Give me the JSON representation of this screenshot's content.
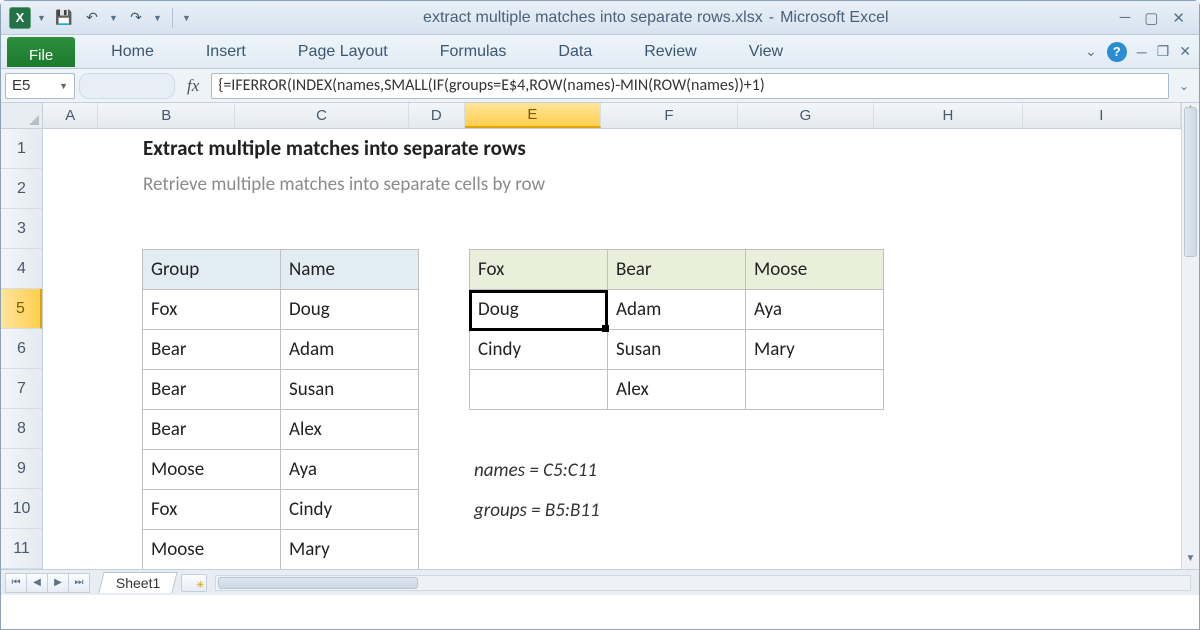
{
  "titlebar": {
    "filename": "extract multiple matches into separate rows.xlsx",
    "separator": "-",
    "app": "Microsoft Excel"
  },
  "ribbon": {
    "file": "File",
    "tabs": [
      "Home",
      "Insert",
      "Page Layout",
      "Formulas",
      "Data",
      "Review",
      "View"
    ]
  },
  "namebox": "E5",
  "fx_label": "fx",
  "formula": "{=IFERROR(INDEX(names,SMALL(IF(groups=E$4,ROW(names)-MIN(ROW(names))+1)",
  "colwidths": {
    "A": 56,
    "B": 138,
    "C": 176,
    "D": 56,
    "E": 138,
    "F": 138,
    "G": 138,
    "H": 150,
    "I": 160
  },
  "columns": [
    "A",
    "B",
    "C",
    "D",
    "E",
    "F",
    "G",
    "H",
    "I"
  ],
  "rows": [
    "1",
    "2",
    "3",
    "4",
    "5",
    "6",
    "7",
    "8",
    "9",
    "10",
    "11"
  ],
  "selected": {
    "col": "E",
    "row": "5",
    "cell": "E5"
  },
  "content": {
    "title": "Extract multiple matches into separate rows",
    "subtitle": "Retrieve multiple matches into separate cells by row",
    "table1": {
      "headers": [
        "Group",
        "Name"
      ],
      "rows": [
        [
          "Fox",
          "Doug"
        ],
        [
          "Bear",
          "Adam"
        ],
        [
          "Bear",
          "Susan"
        ],
        [
          "Bear",
          "Alex"
        ],
        [
          "Moose",
          "Aya"
        ],
        [
          "Fox",
          "Cindy"
        ],
        [
          "Moose",
          "Mary"
        ]
      ]
    },
    "table2": {
      "headers": [
        "Fox",
        "Bear",
        "Moose"
      ],
      "rows": [
        [
          "Doug",
          "Adam",
          "Aya"
        ],
        [
          "Cindy",
          "Susan",
          "Mary"
        ],
        [
          "",
          "Alex",
          ""
        ]
      ]
    },
    "notes": [
      "names = C5:C11",
      "groups = B5:B11"
    ]
  },
  "sheettab": "Sheet1"
}
